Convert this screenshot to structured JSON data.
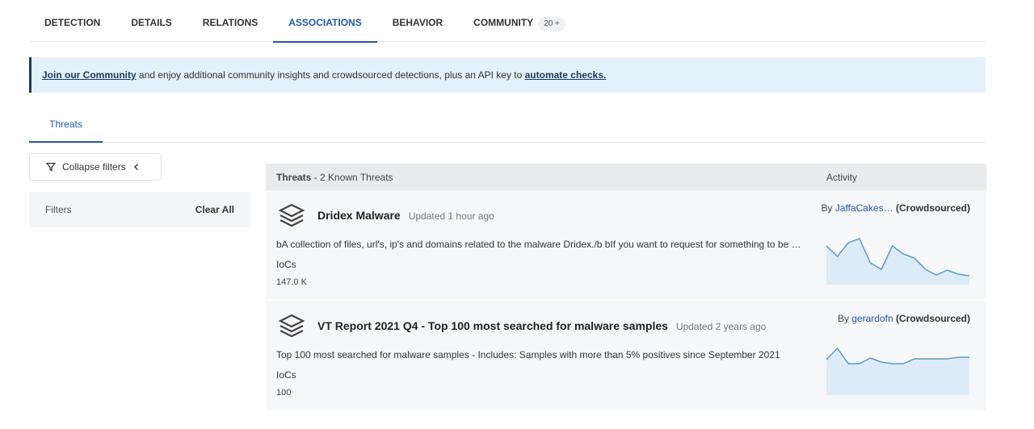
{
  "tabs": [
    {
      "label": "DETECTION"
    },
    {
      "label": "DETAILS"
    },
    {
      "label": "RELATIONS"
    },
    {
      "label": "ASSOCIATIONS",
      "active": true
    },
    {
      "label": "BEHAVIOR"
    },
    {
      "label": "COMMUNITY",
      "badge": "20 +"
    }
  ],
  "banner": {
    "link1": "Join our Community",
    "middle": " and enjoy additional community insights and crowdsourced detections, plus an API key to ",
    "link2": "automate checks."
  },
  "subtab": "Threats",
  "collapse_label": "Collapse filters",
  "filters": {
    "label": "Filters",
    "clear": "Clear All"
  },
  "table": {
    "header_title": "Threats",
    "header_count": " - 2 Known Threats",
    "header_activity": "Activity"
  },
  "threats": [
    {
      "name": "Dridex Malware",
      "updated": "Updated 1 hour ago",
      "description": "bA collection of files, url's, ip's and domains related to the malware Dridex./b bIf you want to request for something to be …",
      "iocs_label": "IoCs",
      "iocs": "147.0 K",
      "by": "By ",
      "author": "JaffaCakes…",
      "source": " (Crowdsourced)",
      "activity": [
        48,
        35,
        52,
        57,
        27,
        19,
        48,
        38,
        33,
        19,
        12,
        18,
        13,
        11
      ]
    },
    {
      "name": "VT Report 2021 Q4 - Top 100 most searched for malware samples",
      "updated": "Updated 2 years ago",
      "description": "Top 100 most searched for malware samples - Includes: Samples with more than 5% positives since September 2021",
      "iocs_label": "IoCs",
      "iocs": "100",
      "by": "By ",
      "author": "gerardofn",
      "source": " (Crowdsourced)",
      "activity": [
        44,
        58,
        39,
        39,
        46,
        41,
        39,
        39,
        45,
        45,
        45,
        45,
        47,
        47
      ]
    }
  ],
  "colors": {
    "accent": "#1f5aa6",
    "spark_line": "#5b9bc4",
    "spark_fill": "#dcebf7"
  }
}
